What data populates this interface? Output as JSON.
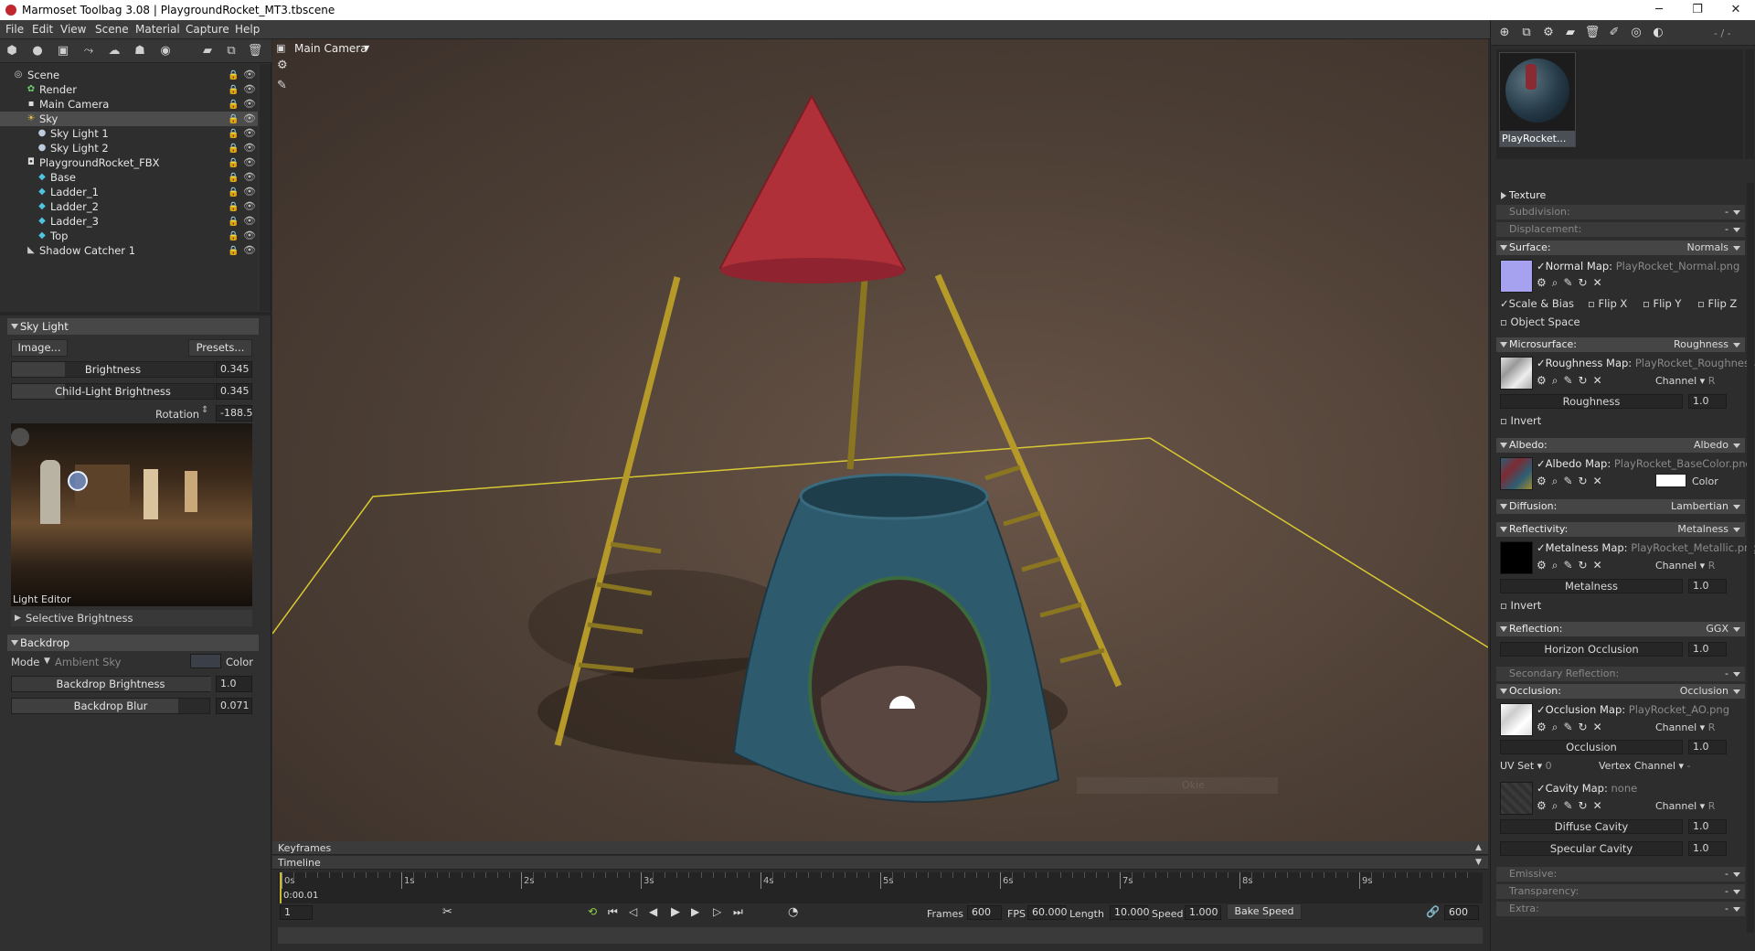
{
  "window": {
    "title": "Marmoset Toolbag 3.08  |  PlaygroundRocket_MT3.tbscene",
    "minimize": "─",
    "restore": "❐",
    "close": "✕"
  },
  "menu": [
    "File",
    "Edit",
    "View",
    "Scene",
    "Material",
    "Capture",
    "Help"
  ],
  "outliner": {
    "items": [
      {
        "label": "Scene",
        "icon": "scene-icon"
      },
      {
        "label": "Render",
        "icon": "render-icon"
      },
      {
        "label": "Main Camera",
        "icon": "camera-icon"
      },
      {
        "label": "Sky",
        "icon": "sky-icon"
      },
      {
        "label": "Sky Light 1",
        "icon": "light-bulb-icon"
      },
      {
        "label": "Sky Light 2",
        "icon": "light-bulb-icon"
      },
      {
        "label": "PlaygroundRocket_FBX",
        "icon": "fbx-icon"
      },
      {
        "label": "Base",
        "icon": "mesh-icon"
      },
      {
        "label": "Ladder_1",
        "icon": "mesh-icon"
      },
      {
        "label": "Ladder_2",
        "icon": "mesh-icon"
      },
      {
        "label": "Ladder_3",
        "icon": "mesh-icon"
      },
      {
        "label": "Top",
        "icon": "mesh-icon"
      },
      {
        "label": "Shadow Catcher 1",
        "icon": "shadow-catcher-icon"
      }
    ]
  },
  "skylight": {
    "header": "Sky Light",
    "image_button": "Image...",
    "presets_button": "Presets...",
    "brightness_label": "Brightness",
    "brightness_value": "0.345",
    "child_label": "Child-Light Brightness",
    "child_value": "0.345",
    "rotation_label": "Rotation",
    "rotation_value": "-188.5",
    "light_editor": "Light Editor",
    "selective": "Selective Brightness"
  },
  "backdrop": {
    "header": "Backdrop",
    "mode_label": "Mode",
    "mode_value": "Ambient Sky",
    "color_label": "Color",
    "brightness_label": "Backdrop Brightness",
    "brightness_value": "1.0",
    "blur_label": "Backdrop Blur",
    "blur_value": "0.071"
  },
  "viewport": {
    "camera": "Main Camera"
  },
  "timeline": {
    "keyframes": "Keyframes",
    "timeline": "Timeline",
    "ticks": [
      "0s",
      "1s",
      "2s",
      "3s",
      "4s",
      "5s",
      "6s",
      "7s",
      "8s",
      "9s"
    ],
    "current_time": "0:00.01",
    "frame_field": "1",
    "frames_label": "Frames",
    "frames_value": "600",
    "fps_label": "FPS",
    "fps_value": "60.000",
    "length_label": "Length",
    "length_value": "10.000",
    "speed_label": "Speed",
    "speed_value": "1.000",
    "bake_speed": "Bake Speed",
    "end_frame": "600"
  },
  "material": {
    "name": "PlayRocket...",
    "counter": "- / -",
    "texture": "Texture",
    "subdivision": "Subdivision:",
    "displacement": "Displacement:",
    "dash": "-",
    "surface": {
      "label": "Surface:",
      "value": "Normals",
      "map_label": "Normal Map:",
      "map_file": "PlayRocket_Normal.png",
      "scale_bias": "Scale & Bias",
      "flipx": "Flip X",
      "flipy": "Flip Y",
      "flipz": "Flip Z",
      "object_space": "Object Space"
    },
    "microsurface": {
      "label": "Microsurface:",
      "value": "Roughness",
      "map_label": "Roughness Map:",
      "map_file": "PlayRocket_Roughness",
      "channel": "Channel",
      "channel_value": "R",
      "slider": "Roughness",
      "slider_value": "1.0",
      "invert": "Invert"
    },
    "albedo": {
      "label": "Albedo:",
      "value": "Albedo",
      "map_label": "Albedo Map:",
      "map_file": "PlayRocket_BaseColor.png",
      "color": "Color"
    },
    "diffusion": {
      "label": "Diffusion:",
      "value": "Lambertian"
    },
    "reflectivity": {
      "label": "Reflectivity:",
      "value": "Metalness",
      "map_label": "Metalness Map:",
      "map_file": "PlayRocket_Metallic.png",
      "channel": "Channel",
      "channel_value": "R",
      "slider": "Metalness",
      "slider_value": "1.0",
      "invert": "Invert"
    },
    "reflection": {
      "label": "Reflection:",
      "value": "GGX",
      "horizon": "Horizon Occlusion",
      "horizon_value": "1.0"
    },
    "secondary": "Secondary Reflection:",
    "occlusion": {
      "label": "Occlusion:",
      "value": "Occlusion",
      "map_label": "Occlusion Map:",
      "map_file": "PlayRocket_AO.png",
      "channel": "Channel",
      "channel_value": "R",
      "slider": "Occlusion",
      "slider_value": "1.0",
      "uvset": "UV Set",
      "uvset_value": "0",
      "vertex": "Vertex Channel",
      "vertex_value": "-",
      "cavity_label": "Cavity Map:",
      "cavity_file": "none",
      "cavity_channel": "Channel",
      "cavity_channel_value": "R",
      "diffuse_cavity": "Diffuse Cavity",
      "diffuse_value": "1.0",
      "specular_cavity": "Specular Cavity",
      "specular_value": "1.0"
    },
    "emissive": "Emissive:",
    "transparency": "Transparency:",
    "extra": "Extra:"
  },
  "ghost_tooltip": "Okie",
  "colors": {
    "accent": "#4a7ab0",
    "rocket_top": "#b0303a",
    "rocket_base": "#2f5a6c",
    "ladder": "#b59a2a",
    "guide": "#d8c832"
  }
}
